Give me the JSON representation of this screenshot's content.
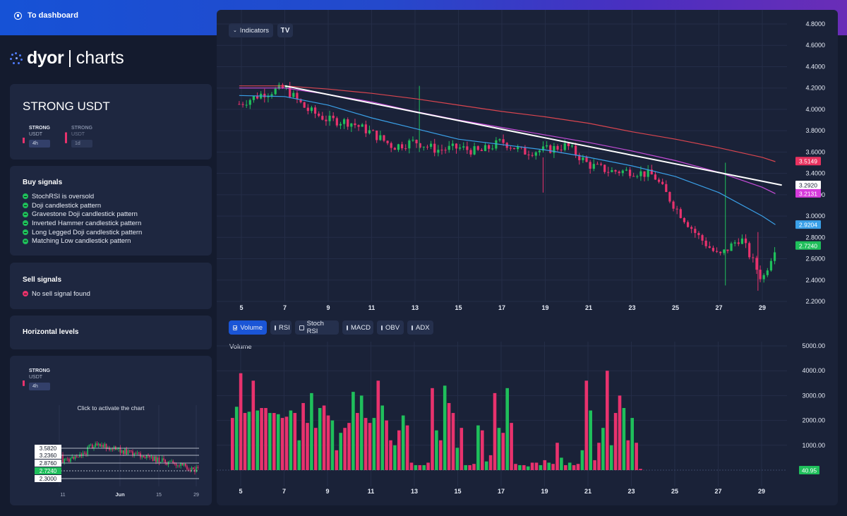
{
  "topbar": {
    "link_label": "To dashboard"
  },
  "logo": {
    "dyor": "dyor",
    "charts": "charts"
  },
  "pair_card": {
    "title": "STRONG USDT",
    "tf1": {
      "base": "STRONG",
      "quote": "USDT",
      "interval": "4h"
    },
    "tf2": {
      "base": "STRONG",
      "quote": "USDT",
      "interval": "1d"
    }
  },
  "buy": {
    "title": "Buy signals",
    "items": [
      "StochRSI is oversold",
      "Doji candlestick pattern",
      "Gravestone Doji candlestick pattern",
      "Inverted Hammer candlestick pattern",
      "Long Legged Doji candlestick pattern",
      "Matching Low candlestick pattern"
    ]
  },
  "sell": {
    "title": "Sell signals",
    "items": [
      "No sell signal found"
    ]
  },
  "horizontal": {
    "title": "Horizontal levels"
  },
  "mini": {
    "base": "STRONG",
    "quote": "USDT",
    "interval": "4h",
    "overlay": "Click to activate the chart",
    "levels": [
      "3.5820",
      "3.2360",
      "2.8760",
      "2.7240",
      "2.3000"
    ],
    "x_labels": [
      "11",
      "Jun",
      "15",
      "29"
    ]
  },
  "toolbar": {
    "indicators": "Indicators"
  },
  "indicators": [
    {
      "label": "Volume",
      "active": true
    },
    {
      "label": "RSI",
      "active": false
    },
    {
      "label": "Stoch RSI",
      "active": false
    },
    {
      "label": "MACD",
      "active": false
    },
    {
      "label": "OBV",
      "active": false
    },
    {
      "label": "ADX",
      "active": false
    }
  ],
  "price_axis": [
    "4.8000",
    "4.6000",
    "4.4000",
    "4.2000",
    "4.0000",
    "3.8000",
    "3.6000",
    "3.4000",
    "3.2000",
    "3.0000",
    "2.8000",
    "2.6000",
    "2.4000",
    "2.2000"
  ],
  "price_badges": [
    {
      "value": "3.5149",
      "color": "#e8325f"
    },
    {
      "value": "3.2920",
      "color": "#ffffff"
    },
    {
      "value": "3.2131",
      "color": "#d63bdc"
    },
    {
      "value": "2.9204",
      "color": "#3aa0e8"
    },
    {
      "value": "2.7240",
      "color": "#1fbf5b"
    }
  ],
  "x_axis": [
    "5",
    "7",
    "9",
    "11",
    "13",
    "15",
    "17",
    "19",
    "21",
    "23",
    "25",
    "27",
    "29"
  ],
  "volume": {
    "label": "Volume",
    "axis": [
      "5000.00",
      "4000.00",
      "3000.00",
      "2000.00",
      "1000.00"
    ],
    "last": "40.95"
  },
  "colors": {
    "up": "#1fbf5b",
    "down": "#e8326d",
    "ma1": "#3aa0e8",
    "ma2": "#c64cd8",
    "ma3": "#d9454f",
    "trend": "#ffffff"
  },
  "chart_data": {
    "type": "candlestick",
    "price_ylim": [
      2.2,
      4.8
    ],
    "trendline": [
      [
        7,
        4.22
      ],
      [
        29.9,
        3.29
      ]
    ],
    "moving_averages": [
      {
        "color": "#3aa0e8",
        "points": [
          [
            4.9,
            4.13
          ],
          [
            7,
            4.12
          ],
          [
            9,
            4.04
          ],
          [
            11,
            3.92
          ],
          [
            13,
            3.82
          ],
          [
            15,
            3.72
          ],
          [
            17,
            3.67
          ],
          [
            19,
            3.62
          ],
          [
            21,
            3.55
          ],
          [
            23,
            3.47
          ],
          [
            25,
            3.37
          ],
          [
            27,
            3.22
          ],
          [
            29,
            3.0
          ],
          [
            29.6,
            2.92
          ]
        ]
      },
      {
        "color": "#c64cd8",
        "points": [
          [
            4.9,
            4.2
          ],
          [
            7,
            4.2
          ],
          [
            9,
            4.14
          ],
          [
            11,
            4.07
          ],
          [
            13,
            3.98
          ],
          [
            15,
            3.9
          ],
          [
            17,
            3.83
          ],
          [
            19,
            3.76
          ],
          [
            21,
            3.69
          ],
          [
            23,
            3.61
          ],
          [
            25,
            3.52
          ],
          [
            27,
            3.41
          ],
          [
            29,
            3.27
          ],
          [
            29.6,
            3.21
          ]
        ]
      },
      {
        "color": "#d9454f",
        "points": [
          [
            4.9,
            4.22
          ],
          [
            7,
            4.22
          ],
          [
            9,
            4.19
          ],
          [
            11,
            4.15
          ],
          [
            13,
            4.1
          ],
          [
            15,
            4.04
          ],
          [
            17,
            3.98
          ],
          [
            19,
            3.93
          ],
          [
            21,
            3.87
          ],
          [
            23,
            3.79
          ],
          [
            25,
            3.72
          ],
          [
            27,
            3.64
          ],
          [
            29,
            3.55
          ],
          [
            29.6,
            3.51
          ]
        ]
      }
    ],
    "volume_ylim": [
      0,
      5000
    ]
  }
}
